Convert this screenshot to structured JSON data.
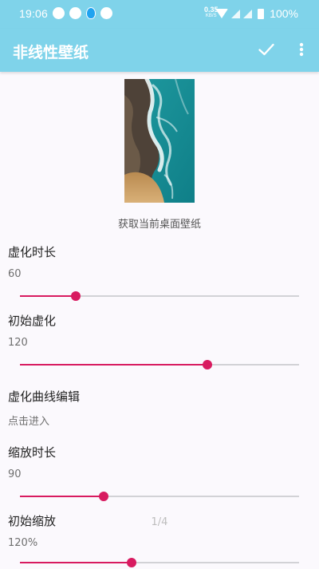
{
  "status_bar": {
    "time": "19:06",
    "net_speed_value": "0.35",
    "net_speed_unit": "KB/S",
    "battery": "100%"
  },
  "toolbar": {
    "title": "非线性壁纸",
    "confirm_icon": "check-icon",
    "more_icon": "more-vert-icon"
  },
  "wallpaper": {
    "label": "获取当前桌面壁纸"
  },
  "settings": [
    {
      "title": "虚化时长",
      "value": "60",
      "level": 0.2
    },
    {
      "title": "初始虚化",
      "value": "120",
      "level": 0.67
    },
    {
      "title": "虚化曲线编辑",
      "value": "点击进入"
    },
    {
      "title": "缩放时长",
      "value": "90",
      "level": 0.3
    },
    {
      "title": "初始缩放",
      "value": "120%",
      "level": 0.4
    }
  ],
  "page_indicator": "1/4",
  "colors": {
    "primary": "#7fd3ea",
    "accent": "#d81b60",
    "background": "#fbf9fd"
  }
}
